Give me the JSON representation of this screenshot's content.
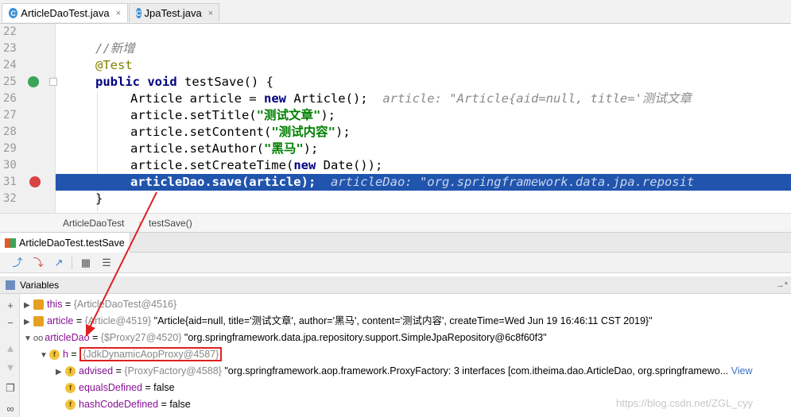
{
  "tabs": [
    {
      "label": "ArticleDaoTest.java",
      "close": "×"
    },
    {
      "label": "JpaTest.java",
      "close": "×"
    }
  ],
  "editor": {
    "lines": [
      {
        "num": "22"
      },
      {
        "num": "23",
        "comment": "//新增"
      },
      {
        "num": "24",
        "annotation": "@Test"
      },
      {
        "num": "25",
        "kw1": "public",
        "kw2": "void",
        "rest": " testSave() {"
      },
      {
        "num": "26",
        "code": "Article article = ",
        "kw": "new",
        "code2": " Article();",
        "hint": "article: \"Article{aid=null, title='测试文章"
      },
      {
        "num": "27",
        "code": "article.setTitle(",
        "str": "\"测试文章\"",
        "end": ");"
      },
      {
        "num": "28",
        "code": "article.setContent(",
        "str": "\"测试内容\"",
        "end": ");"
      },
      {
        "num": "29",
        "code": "article.setAuthor(",
        "str": "\"黑马\"",
        "end": ");"
      },
      {
        "num": "30",
        "code": "article.setCreateTime(",
        "kw": "new",
        "end": " Date());"
      },
      {
        "num": "31",
        "code": "articleDao.save(article);",
        "hint": "articleDao: \"org.springframework.data.jpa.reposit"
      },
      {
        "num": "32",
        "code": "}"
      }
    ]
  },
  "breadcrumb": {
    "class_name": "ArticleDaoTest",
    "method": "testSave()"
  },
  "run_tab": {
    "label": "ArticleDaoTest.testSave"
  },
  "variables_panel": {
    "title": "Variables",
    "pin": "→*"
  },
  "variables": [
    {
      "name": "this",
      "ref": "{ArticleDaoTest@4516}",
      "value": ""
    },
    {
      "name": "article",
      "ref": "{Article@4519}",
      "value": "\"Article{aid=null, title='测试文章', author='黑马', content='测试内容', createTime=Wed Jun 19 16:46:11 CST 2019}\""
    },
    {
      "name": "articleDao",
      "ref": "{$Proxy27@4520}",
      "value": "\"org.springframework.data.jpa.repository.support.SimpleJpaRepository@6c8f60f3\""
    },
    {
      "name": "h",
      "ref": "{JdkDynamicAopProxy@4587}",
      "value": ""
    },
    {
      "name": "advised",
      "ref": "{ProxyFactory@4588}",
      "value": "\"org.springframework.aop.framework.ProxyFactory: 3 interfaces [com.itheima.dao.ArticleDao, org.springframewo...",
      "link": "View"
    },
    {
      "name": "equalsDefined",
      "ref": "",
      "value": "false"
    },
    {
      "name": "hashCodeDefined",
      "ref": "",
      "value": "false"
    }
  ],
  "watermark": "https://blog.csdn.net/ZGL_cyy",
  "colors": {
    "selection": "#2154ad",
    "highlight_box": "#e02020",
    "arrow": "#e02020"
  }
}
